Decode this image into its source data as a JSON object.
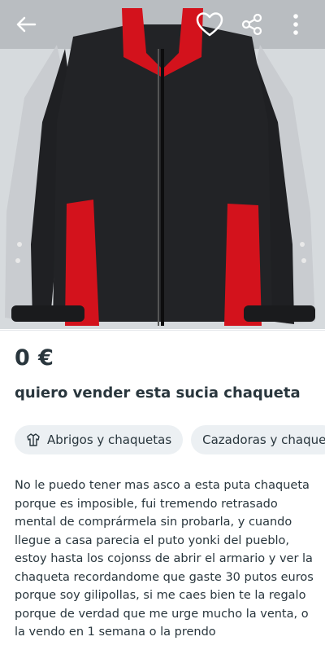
{
  "listing": {
    "price": "0 €",
    "title": "quiero vender esta sucia chaqueta",
    "description": "No le puedo tener mas asco a esta puta chaqueta porque es imposible, fui tremendo retrasado mental de comprármela sin probarla, y cuando llegue a casa parecia el puto yonki del pueblo, estoy hasta los cojonss de abrir el armario y ver la chaqueta recordandome que gaste 30 putos euros porque soy gilipollas, si me caes bien te la regalo porque de verdad que me urge mucho la venta, o la vendo en 1 semana o la prendo"
  },
  "categories": [
    {
      "label": "Abrigos y chaquetas",
      "icon": "jacket-icon"
    },
    {
      "label": "Cazadoras y chaque"
    }
  ],
  "topbar": {
    "icons": [
      "back-arrow-icon",
      "heart-icon",
      "share-icon",
      "more-vertical-icon"
    ]
  },
  "colors": {
    "text": "#29363d",
    "chip_bg": "#ecf0f3",
    "jacket_black": "#202124",
    "jacket_red": "#d3121c",
    "jacket_silver": "#c9ccd0"
  }
}
